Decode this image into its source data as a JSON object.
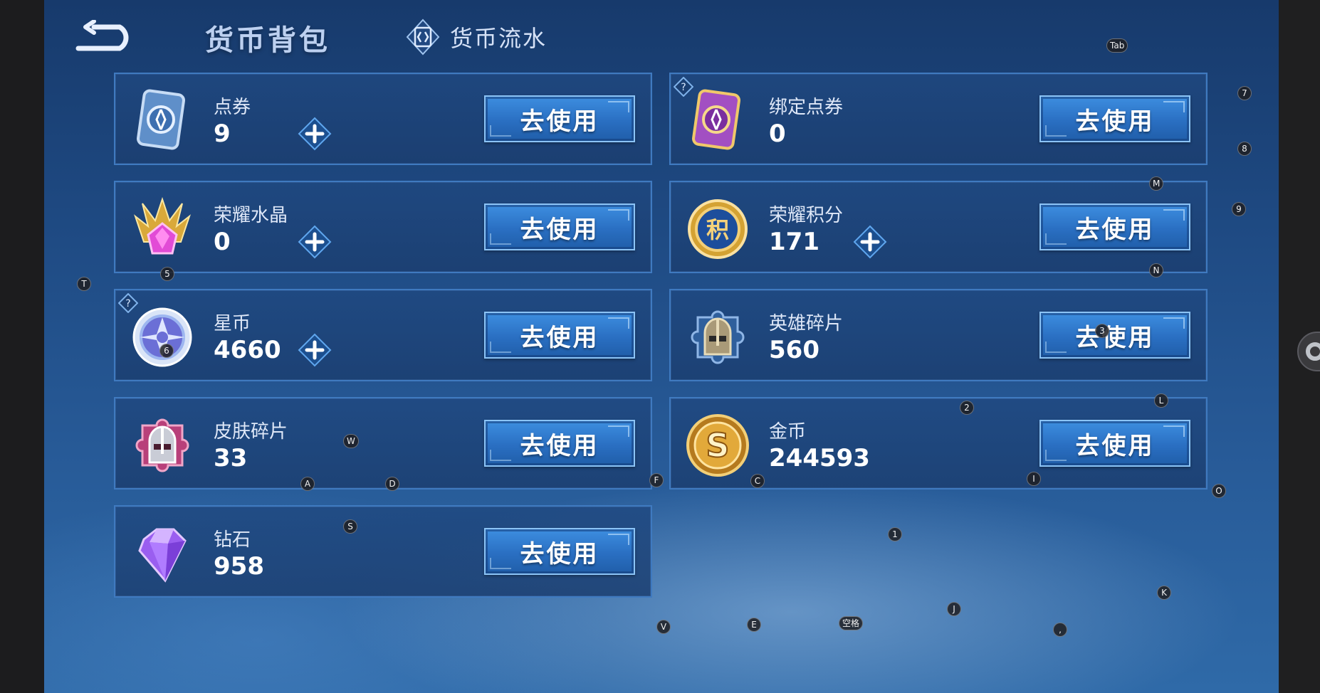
{
  "header": {
    "back_icon": "back-arrow-icon",
    "title": "货币背包",
    "ledger_tab_label": "货币流水",
    "ledger_icon": "currency-ledger-icon"
  },
  "currencies": [
    {
      "name": "点券",
      "amount": "9",
      "icon": "coupon-card-icon",
      "has_plus": true,
      "has_help": false,
      "button": "去使用"
    },
    {
      "name": "绑定点券",
      "amount": "0",
      "icon": "bound-coupon-card-icon",
      "has_plus": false,
      "has_help": true,
      "button": "去使用"
    },
    {
      "name": "荣耀水晶",
      "amount": "0",
      "icon": "glory-crystal-icon",
      "has_plus": true,
      "has_help": false,
      "button": "去使用"
    },
    {
      "name": "荣耀积分",
      "amount": "171",
      "icon": "glory-points-icon",
      "has_plus": true,
      "has_help": false,
      "button": "去使用"
    },
    {
      "name": "星币",
      "amount": "4660",
      "icon": "star-coin-icon",
      "has_plus": true,
      "has_help": true,
      "button": "去使用"
    },
    {
      "name": "英雄碎片",
      "amount": "560",
      "icon": "hero-fragment-icon",
      "has_plus": false,
      "has_help": false,
      "button": "去使用"
    },
    {
      "name": "皮肤碎片",
      "amount": "33",
      "icon": "skin-fragment-icon",
      "has_plus": false,
      "has_help": false,
      "button": "去使用"
    },
    {
      "name": "金币",
      "amount": "244593",
      "icon": "gold-coin-icon",
      "has_plus": false,
      "has_help": false,
      "button": "去使用"
    },
    {
      "name": "钻石",
      "amount": "958",
      "icon": "diamond-icon",
      "has_plus": false,
      "has_help": false,
      "button": "去使用"
    }
  ],
  "key_hints": [
    "Tab",
    "7",
    "8",
    "M",
    "9",
    "N",
    "T",
    "5",
    "6",
    "3",
    "W",
    "2",
    "L",
    "A",
    "D",
    "F",
    "C",
    "I",
    "O",
    "S",
    "1",
    "K",
    "J",
    "V",
    "E",
    "空格",
    ","
  ],
  "colors": {
    "background": "#1f4b84",
    "card": "#1f4880",
    "card_border": "#3f7ac0",
    "button": "#2a6fc2",
    "plus": "#3a8ee8"
  }
}
